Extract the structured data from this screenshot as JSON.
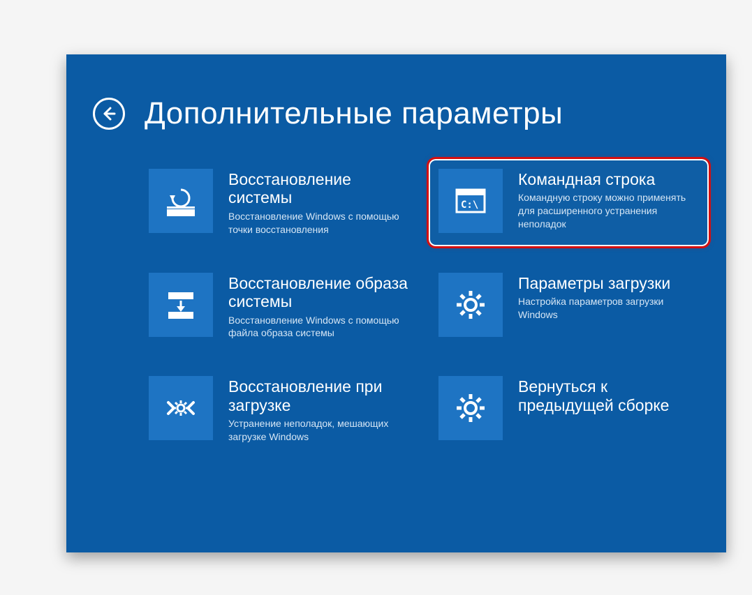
{
  "header": {
    "title": "Дополнительные параметры"
  },
  "options": {
    "system_restore": {
      "title": "Восстановление системы",
      "desc": "Восстановление Windows с помощью точки восстановления"
    },
    "image_recovery": {
      "title": "Восстановление образа системы",
      "desc": "Восстановление Windows с помощью файла образа системы"
    },
    "startup_repair": {
      "title": "Восстановление при загрузке",
      "desc": "Устранение неполадок, мешающих загрузке Windows"
    },
    "command_prompt": {
      "title": "Командная строка",
      "desc": "Командную строку можно применять для расширенного устранения неполадок"
    },
    "startup_settings": {
      "title": "Параметры загрузки",
      "desc": "Настройка параметров загрузки Windows"
    },
    "go_back": {
      "title": "Вернуться к предыдущей сборке",
      "desc": ""
    }
  }
}
